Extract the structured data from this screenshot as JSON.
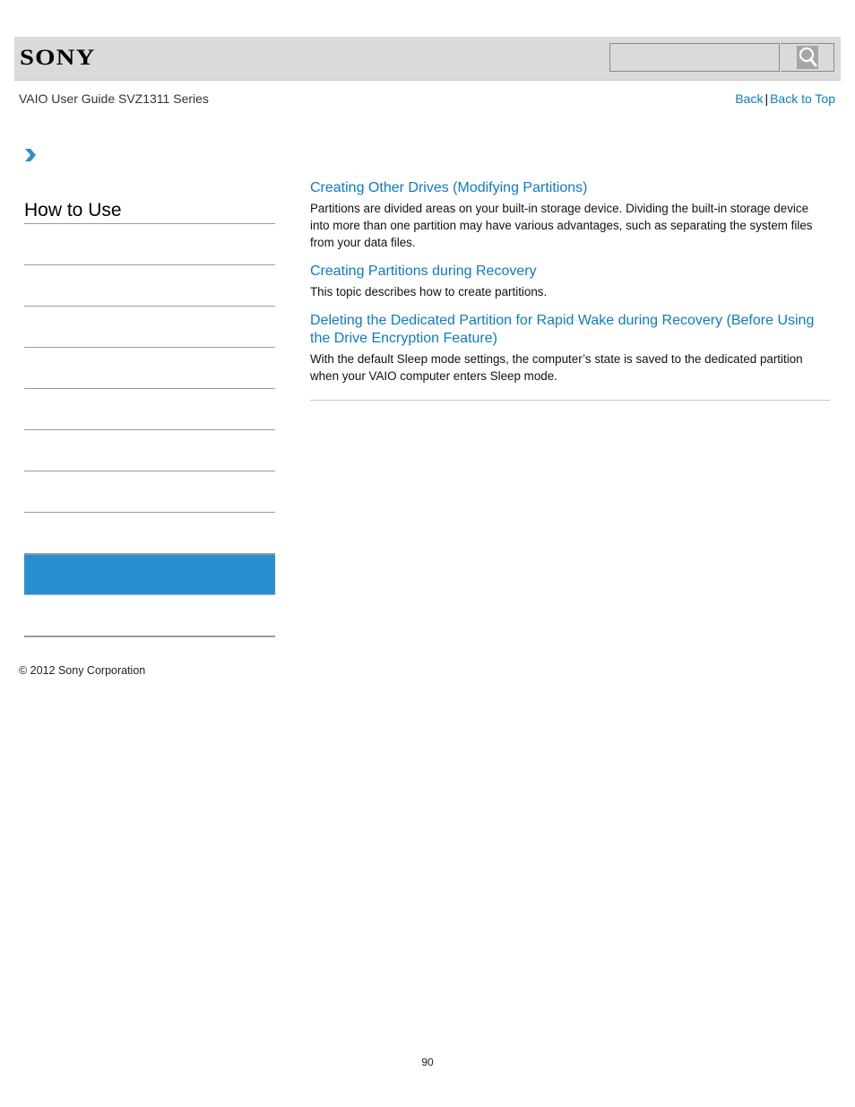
{
  "header": {
    "brand": "SONY",
    "search": {
      "value": "",
      "placeholder": ""
    },
    "search_button_icon": "magnifier-icon"
  },
  "subheader": {
    "guide_title": "VAIO User Guide SVZ1311 Series",
    "links": {
      "back": "Back",
      "separator": "|",
      "back_to_top": "Back to Top"
    }
  },
  "breadcrumb": {
    "icon": "chevron-right-icon"
  },
  "sidebar": {
    "title": "How to Use",
    "items": [
      {
        "label": "",
        "active": false
      },
      {
        "label": "",
        "active": false
      },
      {
        "label": "",
        "active": false
      },
      {
        "label": "",
        "active": false
      },
      {
        "label": "",
        "active": false
      },
      {
        "label": "",
        "active": false
      },
      {
        "label": "",
        "active": false
      },
      {
        "label": "",
        "active": false
      },
      {
        "label": "",
        "active": true
      },
      {
        "label": "",
        "active": false
      }
    ],
    "active_color": "#298fce"
  },
  "main": {
    "topics": [
      {
        "title": "Creating Other Drives (Modifying Partitions)",
        "description": "Partitions are divided areas on your built-in storage device. Dividing the built-in storage device into more than one partition may have various advantages, such as separating the system files from your data files."
      },
      {
        "title": "Creating Partitions during Recovery",
        "description": "This topic describes how to create partitions."
      },
      {
        "title": "Deleting the Dedicated Partition for Rapid Wake during Recovery (Before Using the Drive Encryption Feature)",
        "description": "With the default Sleep mode settings, the computer’s state is saved to the dedicated partition when your VAIO computer enters Sleep mode."
      }
    ],
    "link_color": "#0b7bc6"
  },
  "footer": {
    "copyright": "© 2012 Sony Corporation",
    "page_number": "90"
  }
}
